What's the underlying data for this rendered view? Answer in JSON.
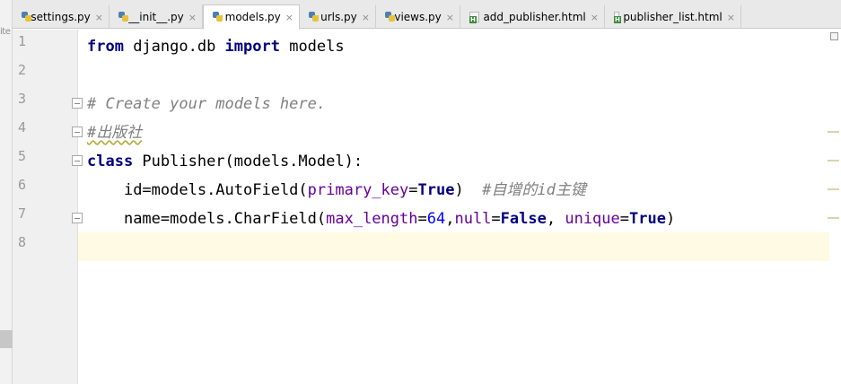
{
  "left_panel": {
    "cut_text": "ite"
  },
  "tabs": [
    {
      "label": "settings.py",
      "close": "×",
      "icon": "python-file-icon"
    },
    {
      "label": "__init__.py",
      "close": "×",
      "icon": "python-file-icon"
    },
    {
      "label": "models.py",
      "close": "×",
      "icon": "python-file-icon",
      "active": true
    },
    {
      "label": "urls.py",
      "close": "×",
      "icon": "python-file-icon"
    },
    {
      "label": "views.py",
      "close": "×",
      "icon": "python-file-icon"
    },
    {
      "label": "add_publisher.html",
      "close": "×",
      "icon": "html-file-icon"
    },
    {
      "label": "publisher_list.html",
      "close": "×",
      "icon": "html-file-icon"
    }
  ],
  "line_numbers": [
    "1",
    "2",
    "3",
    "4",
    "5",
    "6",
    "7",
    "8"
  ],
  "current_line": 8,
  "code": {
    "line1": {
      "kw_from": "from",
      "mod": " django.db ",
      "kw_import": "import",
      "name": " models"
    },
    "line3": {
      "comment": "# Create your models here."
    },
    "line4": {
      "comment": "#出版社"
    },
    "line5": {
      "kw_class": "class",
      "decl": " Publisher(models.Model):"
    },
    "line6": {
      "indent": "    ",
      "lhs": "id=models.AutoField(",
      "param": "primary_key",
      "eq": "=",
      "kw_true": "True",
      "close": ")  ",
      "comment": "#自增的id主键"
    },
    "line7": {
      "indent": "    ",
      "lhs": "name=models.CharField(",
      "param1": "max_length",
      "eq1": "=",
      "num": "64",
      "comma1": ",",
      "param2": "null",
      "eq2": "=",
      "kw_false": "False",
      "comma2": ", ",
      "param3": "unique",
      "eq3": "=",
      "kw_true": "True",
      "close": ")"
    }
  },
  "colors": {
    "keyword": "#000080",
    "comment": "#808080",
    "parameter": "#660099",
    "number": "#0000ff",
    "current_line_bg": "#fffae3"
  }
}
